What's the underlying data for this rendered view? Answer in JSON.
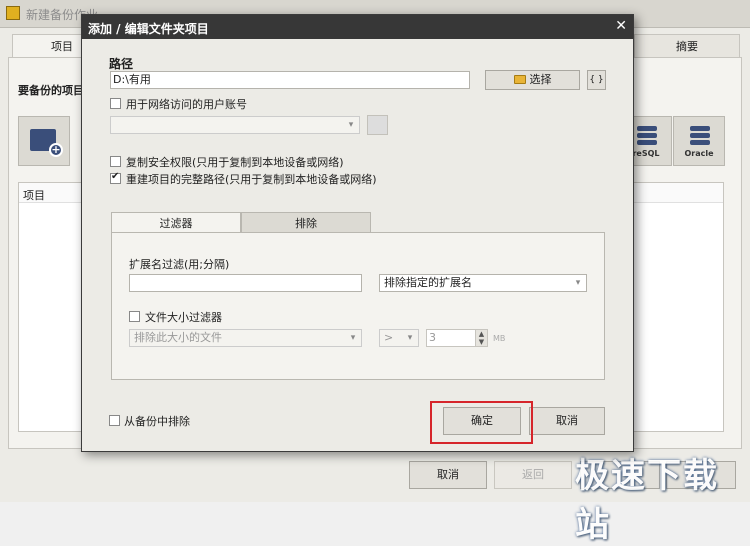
{
  "background": {
    "window_title": "新建备份作业",
    "tabs": [
      "项目",
      "摘要"
    ],
    "section_title": "要备份的项目",
    "db_buttons": [
      "reSQL",
      "Oracle"
    ],
    "list_header": "项目",
    "buttons": {
      "cancel": "取消",
      "back": "返回",
      "next": ""
    }
  },
  "watermark": "极速下载站",
  "dialog": {
    "title": "添加 / 编辑文件夹项目",
    "close_glyph": "✕",
    "path_label": "路径",
    "path_value": "D:\\有用",
    "select_button": "选择",
    "braces_button": "{ }",
    "network_user_checkbox": {
      "label": "用于网络访问的用户账号",
      "checked": false
    },
    "copy_security_checkbox": {
      "label": "复制安全权限(只用于复制到本地设备或网络)",
      "checked": false
    },
    "rebuild_path_checkbox": {
      "label": "重建项目的完整路径(只用于复制到本地设备或网络)",
      "checked": true
    },
    "tabs": [
      "过滤器",
      "排除"
    ],
    "ext_filter_label": "扩展名过滤(用;分隔)",
    "ext_filter_value": "",
    "ext_mode_select": "排除指定的扩展名",
    "size_filter_checkbox": {
      "label": "文件大小过滤器",
      "checked": false
    },
    "size_mode_select": "排除此大小的文件",
    "size_op_select": ">",
    "size_value": "3",
    "size_unit": "MB",
    "exclude_from_backup_checkbox": {
      "label": "从备份中排除",
      "checked": false
    },
    "ok_button": "确定",
    "cancel_button": "取消"
  }
}
